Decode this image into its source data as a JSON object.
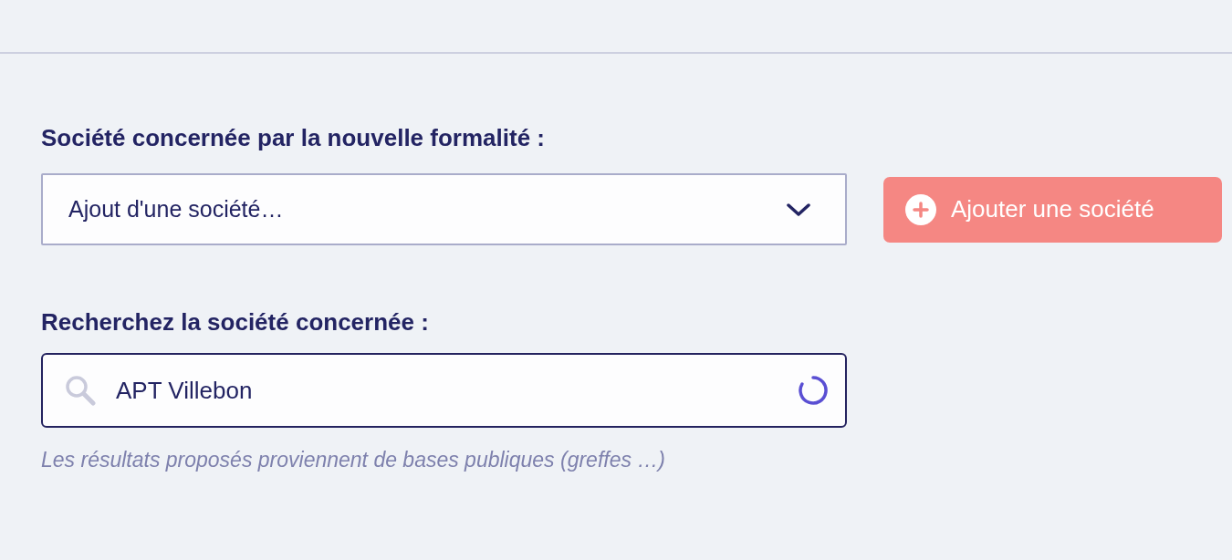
{
  "company_select": {
    "label": "Société concernée par la nouvelle formalité :",
    "value": "Ajout d'une société…",
    "focused": false
  },
  "add_button": {
    "label": "Ajouter une société"
  },
  "search": {
    "label": "Recherchez la société concernée :",
    "value": "APT Villebon",
    "focused": true,
    "loading": true,
    "hint": "Les résultats proposés proviennent de bases publiques (greffes …)"
  }
}
